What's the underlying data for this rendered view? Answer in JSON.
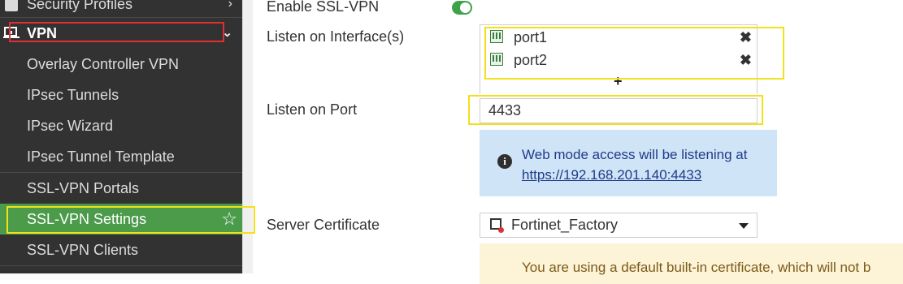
{
  "sidebar": {
    "security_profiles": "Security Profiles",
    "vpn": "VPN",
    "items": [
      {
        "label": "Overlay Controller VPN"
      },
      {
        "label": "IPsec Tunnels"
      },
      {
        "label": "IPsec Wizard"
      },
      {
        "label": "IPsec Tunnel Template"
      },
      {
        "label": "SSL-VPN Portals"
      },
      {
        "label": "SSL-VPN Settings",
        "active": true
      },
      {
        "label": "SSL-VPN Clients"
      }
    ]
  },
  "form": {
    "enable_ssl_vpn": {
      "label": "Enable SSL-VPN",
      "enabled": true
    },
    "listen_interfaces": {
      "label": "Listen on Interface(s)",
      "ports": [
        "port1",
        "port2"
      ],
      "add_symbol": "+"
    },
    "listen_port": {
      "label": "Listen on Port",
      "value": "4433"
    },
    "info": {
      "text": "Web mode access will be listening at",
      "link": "https://192.168.201.140:4433"
    },
    "server_certificate": {
      "label": "Server Certificate",
      "value": "Fortinet_Factory"
    },
    "warning": {
      "text": "You are using a default built-in certificate, which will not b"
    }
  },
  "colors": {
    "sidebar_bg": "#323232",
    "active_item": "#4b9b4b",
    "toggle_on": "#3fa24a",
    "info_bg": "#cfe4f7",
    "warning_bg": "#fdf3d6",
    "highlight_red": "#e03030",
    "highlight_yellow": "#f2e11a"
  },
  "icons": {
    "sidebar_item_star": "star-outline-icon",
    "vpn": "vpn-monitor-icon",
    "remove": "close-icon",
    "info": "info-icon",
    "certificate": "certificate-icon",
    "dropdown": "caret-down-icon"
  }
}
